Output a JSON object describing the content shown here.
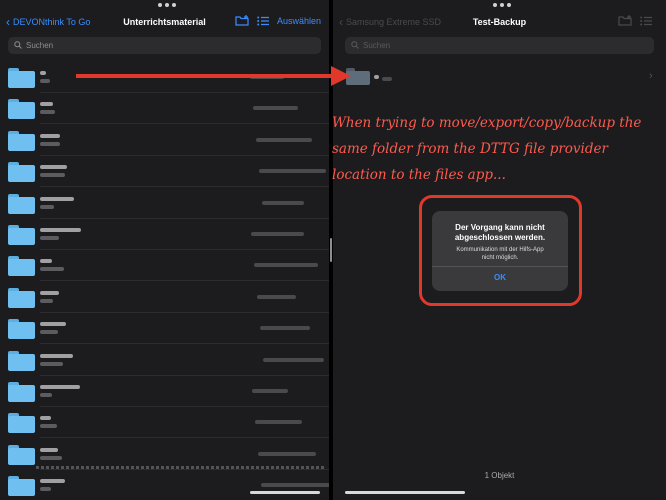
{
  "left_pane": {
    "back_label": "DEVONthink To Go",
    "title": "Unterrichtsmaterial",
    "select_label": "Auswählen",
    "search_placeholder": "Suchen",
    "icons": [
      "new-folder-icon",
      "list-view-icon",
      "search-icon"
    ]
  },
  "right_pane": {
    "back_label": "Samsung Extreme SSD",
    "title": "Test-Backup",
    "search_placeholder": "Suchen",
    "item_count": "1 Objekt",
    "icons": [
      "new-folder-icon",
      "list-view-icon",
      "folder-icon"
    ]
  },
  "annotation": "When trying to move/export/copy/backup the same folder from the DTTG file provider location to the files app...",
  "dialog": {
    "title": "Der Vorgang kann nicht\nabgeschlossen werden.",
    "message": "Kommunikation mit der Hilfs-App\nnicht möglich.",
    "ok_label": "OK"
  },
  "colors": {
    "accent": "#3a8dff",
    "annotation_red": "#e0392c",
    "folder_blue": "#6fc0f0"
  }
}
